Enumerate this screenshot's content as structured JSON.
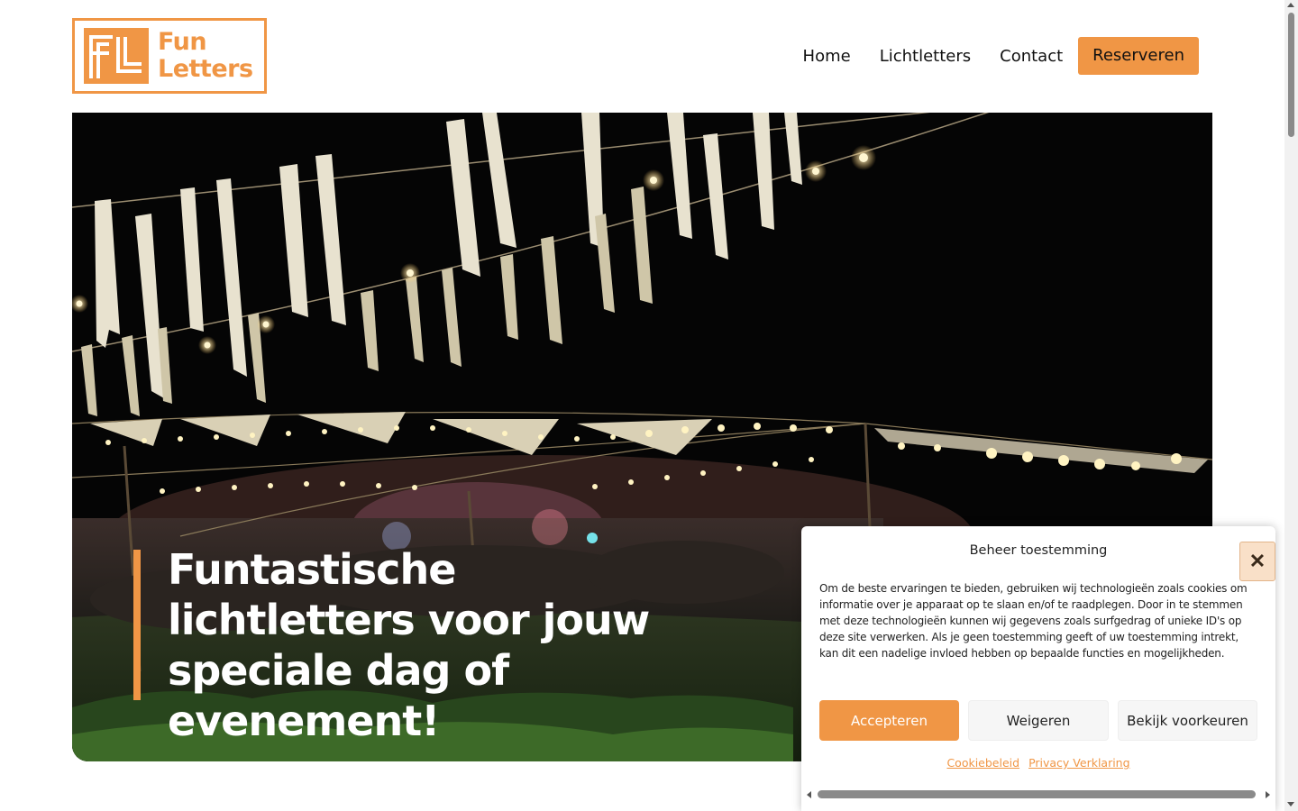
{
  "header": {
    "logo_text_line1": "Fun",
    "logo_text_line2": "Letters",
    "logo_mark": "FL"
  },
  "nav": {
    "items": [
      {
        "label": "Home"
      },
      {
        "label": "Lichtletters"
      },
      {
        "label": "Contact"
      }
    ],
    "cta_label": "Reserveren"
  },
  "hero": {
    "title": "Funtastische lichtletters voor jouw speciale dag of evenement!",
    "image_icon": "festival-night-photo"
  },
  "cookie": {
    "title": "Beheer toestemming",
    "body": "Om de beste ervaringen te bieden, gebruiken wij technologieën zoals cookies om informatie over je apparaat op te slaan en/of te raadplegen. Door in te stemmen met deze technologieën kunnen wij gegevens zoals surfgedrag of unieke ID's op deze site verwerken. Als je geen toestemming geeft of uw toestemming intrekt, kan dit een nadelige invloed hebben op bepaalde functies en mogelijkheden.",
    "accept_label": "Accepteren",
    "deny_label": "Weigeren",
    "prefs_label": "Bekijk voorkeuren",
    "cookie_policy_link": "Cookiebeleid",
    "privacy_link": "Privacy Verklaring",
    "close_icon": "close-icon"
  },
  "colors": {
    "accent": "#f09645",
    "text": "#111111",
    "hero_bg": "#050505"
  }
}
